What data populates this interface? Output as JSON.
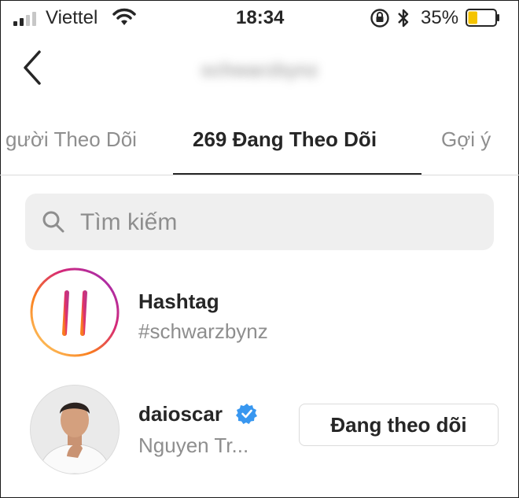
{
  "status_bar": {
    "carrier": "Viettel",
    "time": "18:34",
    "battery_percent": "35%",
    "battery_level": 0.35,
    "battery_color": "#f5c400"
  },
  "nav": {
    "title": "schwarzbynz",
    "back_icon": "chevron-left-icon"
  },
  "tabs": [
    {
      "label": "gười Theo Dõi",
      "active": false
    },
    {
      "label": "269 Đang Theo Dõi",
      "active": true
    },
    {
      "label": "Gợi ý",
      "active": false
    }
  ],
  "search": {
    "placeholder": "Tìm kiếm",
    "value": ""
  },
  "list": [
    {
      "name": "Hashtag",
      "subtitle": "#schwarzbynz",
      "icon": "hashtag-icon"
    },
    {
      "name": "daioscar",
      "subtitle": "Nguyen Tr...",
      "verified": true,
      "button_label": "Đang theo dõi"
    }
  ],
  "colors": {
    "accent_gradient_start": "#feda75",
    "accent_gradient_mid": "#d62976",
    "accent_gradient_end": "#962fbf",
    "verified_blue": "#3897f0"
  }
}
